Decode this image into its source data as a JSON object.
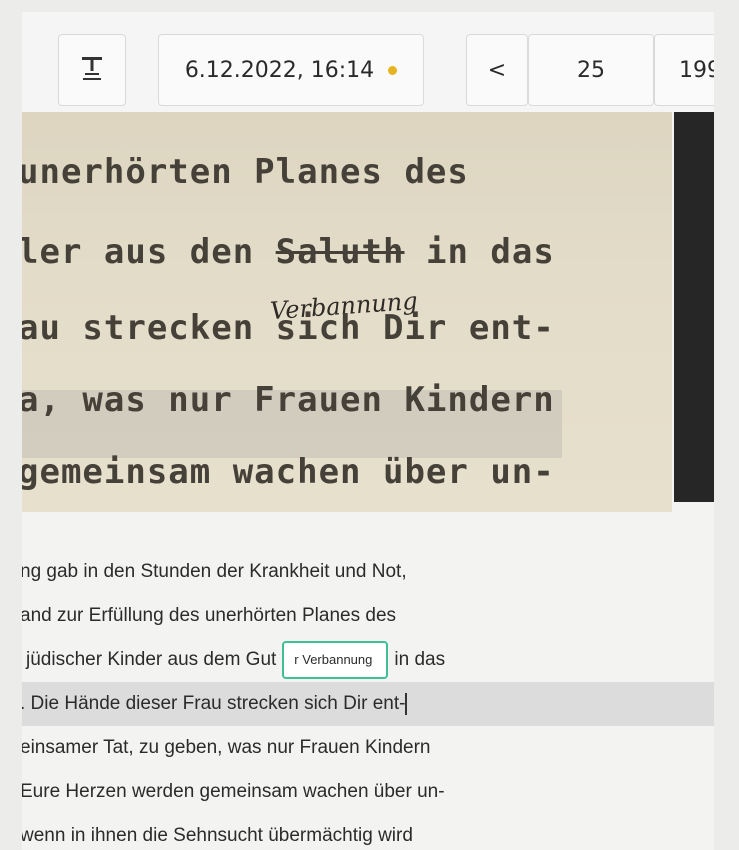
{
  "toolbar": {
    "tool_icon": "text-format-icon",
    "datetime": "6.12.2022, 16:14",
    "status_color": "#e6b421",
    "prev_icon": "chevron-left-icon",
    "prev_glyph": "<",
    "page": "25",
    "total_partial": "199"
  },
  "scan": {
    "lines": [
      "unerhörten Planes des",
      "ler aus den",
      "Saluth",
      "in das",
      "au strecken sich Dir ent-",
      "a, was nur Frauen Kindern",
      "gemeinsam wachen über un-"
    ],
    "handwritten": "Verbannung"
  },
  "transcript": {
    "line1": "ng gab in den Stunden der Krankheit und Not,",
    "line2": "and zur Erfüllung des unerhörten Planes des",
    "line3_prefix": "jüdischer Kinder aus dem Gut",
    "line3_tag": "r Verbannung",
    "line3_suffix": "in das",
    "line4": ". Die Hände dieser Frau strecken sich Dir ent-",
    "line5": "einsamer Tat, zu geben, was nur Frauen Kindern",
    "line6": "Eure Herzen werden gemeinsam wachen über un-",
    "line7": "wenn in ihnen die Sehnsucht übermächtig wird"
  }
}
